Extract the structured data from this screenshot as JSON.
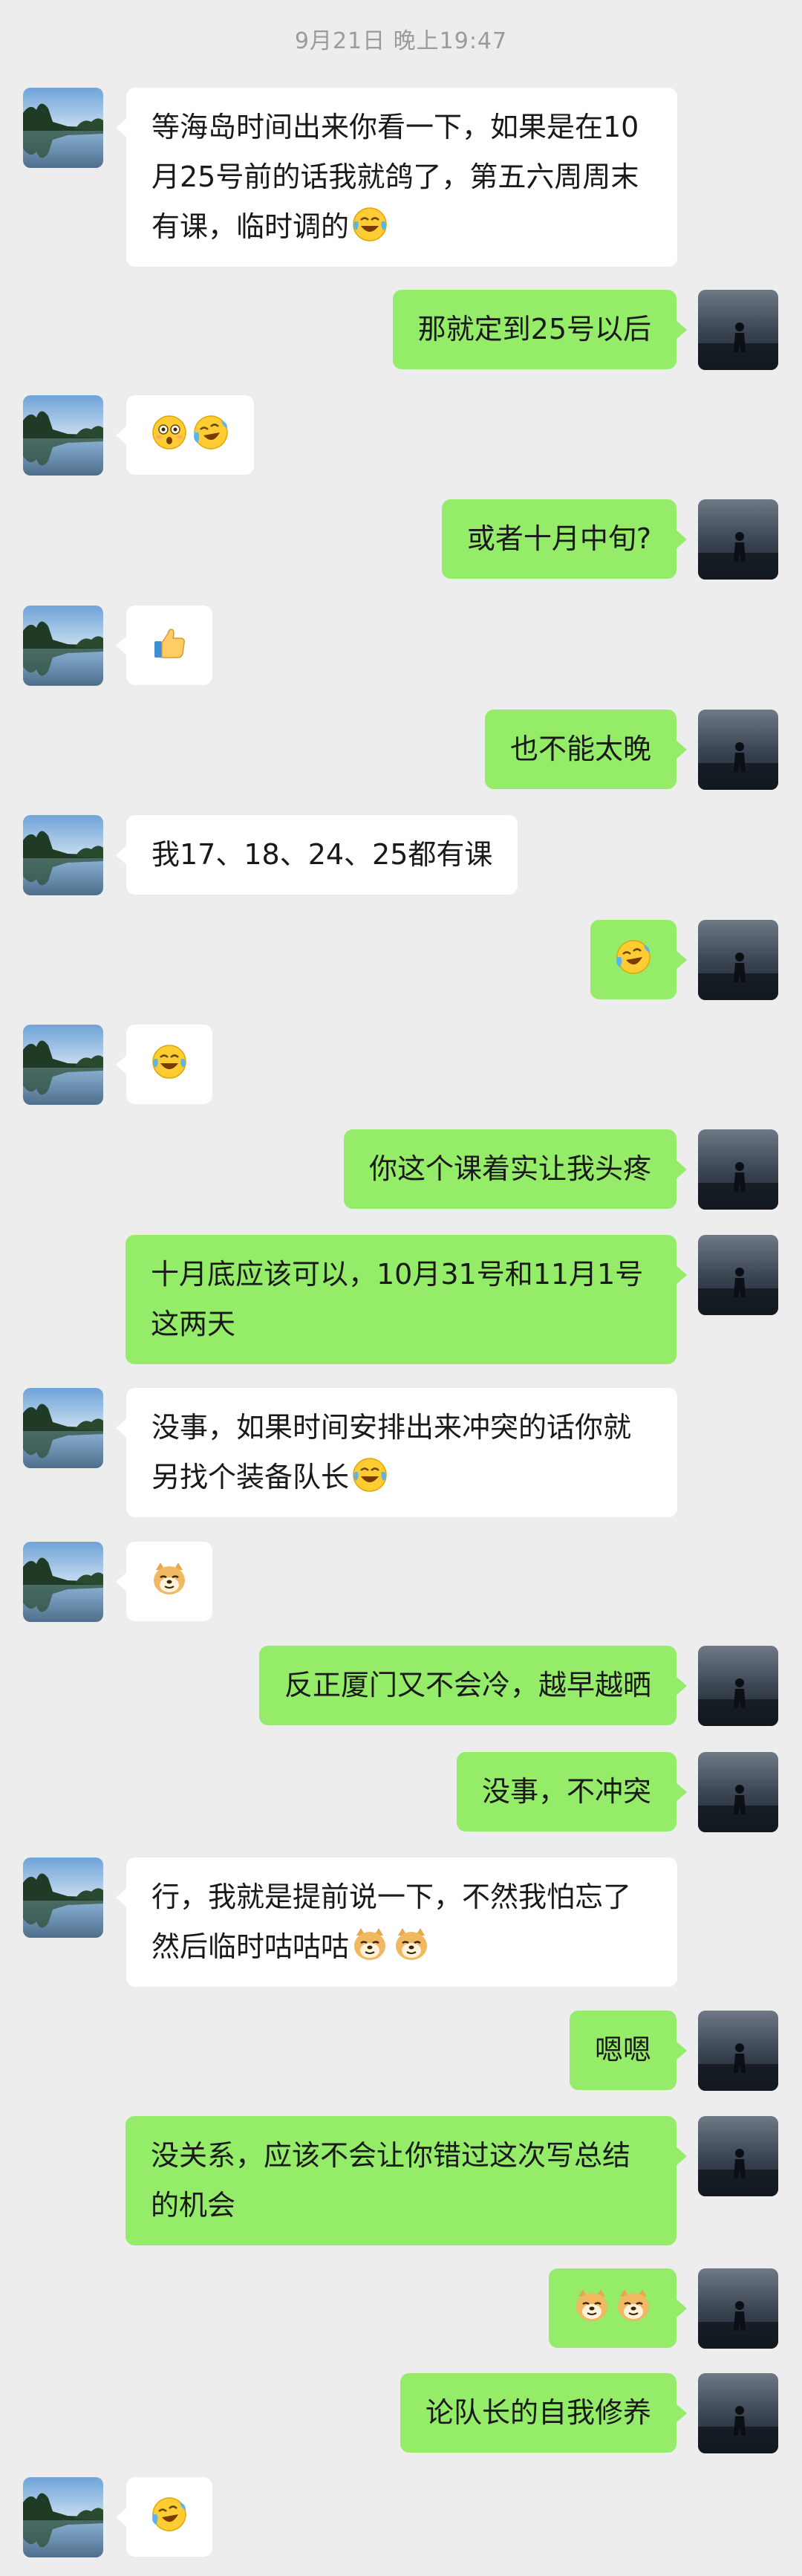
{
  "header": {
    "timestamp": "9月21日 晚上19:47"
  },
  "colors": {
    "background": "#ededed",
    "incoming_bubble": "#ffffff",
    "outgoing_bubble": "#95ec69",
    "timestamp_text": "#9b9b9b"
  },
  "messages": [
    {
      "side": "left",
      "text": "等海岛时间出来你看一下，如果是在10月25号前的话我就鸽了，第五六周周末有课，临时调的",
      "emoji": [
        "tears-of-joy"
      ]
    },
    {
      "side": "right",
      "text": "那就定到25号以后"
    },
    {
      "side": "left",
      "text": "",
      "emoji": [
        "surprised-face",
        "crying-laugh"
      ]
    },
    {
      "side": "right",
      "text": "或者十月中旬?"
    },
    {
      "side": "left",
      "text": "",
      "emoji": [
        "thumbs-up"
      ]
    },
    {
      "side": "right",
      "text": "也不能太晚"
    },
    {
      "side": "left",
      "text": "我17、18、24、25都有课"
    },
    {
      "side": "right",
      "text": "",
      "emoji": [
        "crying-laugh"
      ]
    },
    {
      "side": "left",
      "text": "",
      "emoji": [
        "tears-of-joy"
      ]
    },
    {
      "side": "right",
      "text": "你这个课着实让我头疼"
    },
    {
      "side": "right",
      "text": "十月底应该可以，10月31号和11月1号这两天"
    },
    {
      "side": "left",
      "text": "没事，如果时间安排出来冲突的话你就另找个装备队长",
      "emoji": [
        "tears-of-joy"
      ]
    },
    {
      "side": "left",
      "text": "",
      "emoji": [
        "doge"
      ]
    },
    {
      "side": "right",
      "text": "反正厦门又不会冷，越早越晒"
    },
    {
      "side": "right",
      "text": "没事，不冲突"
    },
    {
      "side": "left",
      "text": "行，我就是提前说一下，不然我怕忘了然后临时咕咕咕",
      "emoji": [
        "doge",
        "doge"
      ]
    },
    {
      "side": "right",
      "text": "嗯嗯"
    },
    {
      "side": "right",
      "text": "没关系，应该不会让你错过这次写总结的机会"
    },
    {
      "side": "right",
      "text": "",
      "emoji": [
        "doge",
        "doge"
      ]
    },
    {
      "side": "right",
      "text": "论队长的自我修养"
    },
    {
      "side": "left",
      "text": "",
      "emoji": [
        "crying-laugh"
      ]
    }
  ]
}
